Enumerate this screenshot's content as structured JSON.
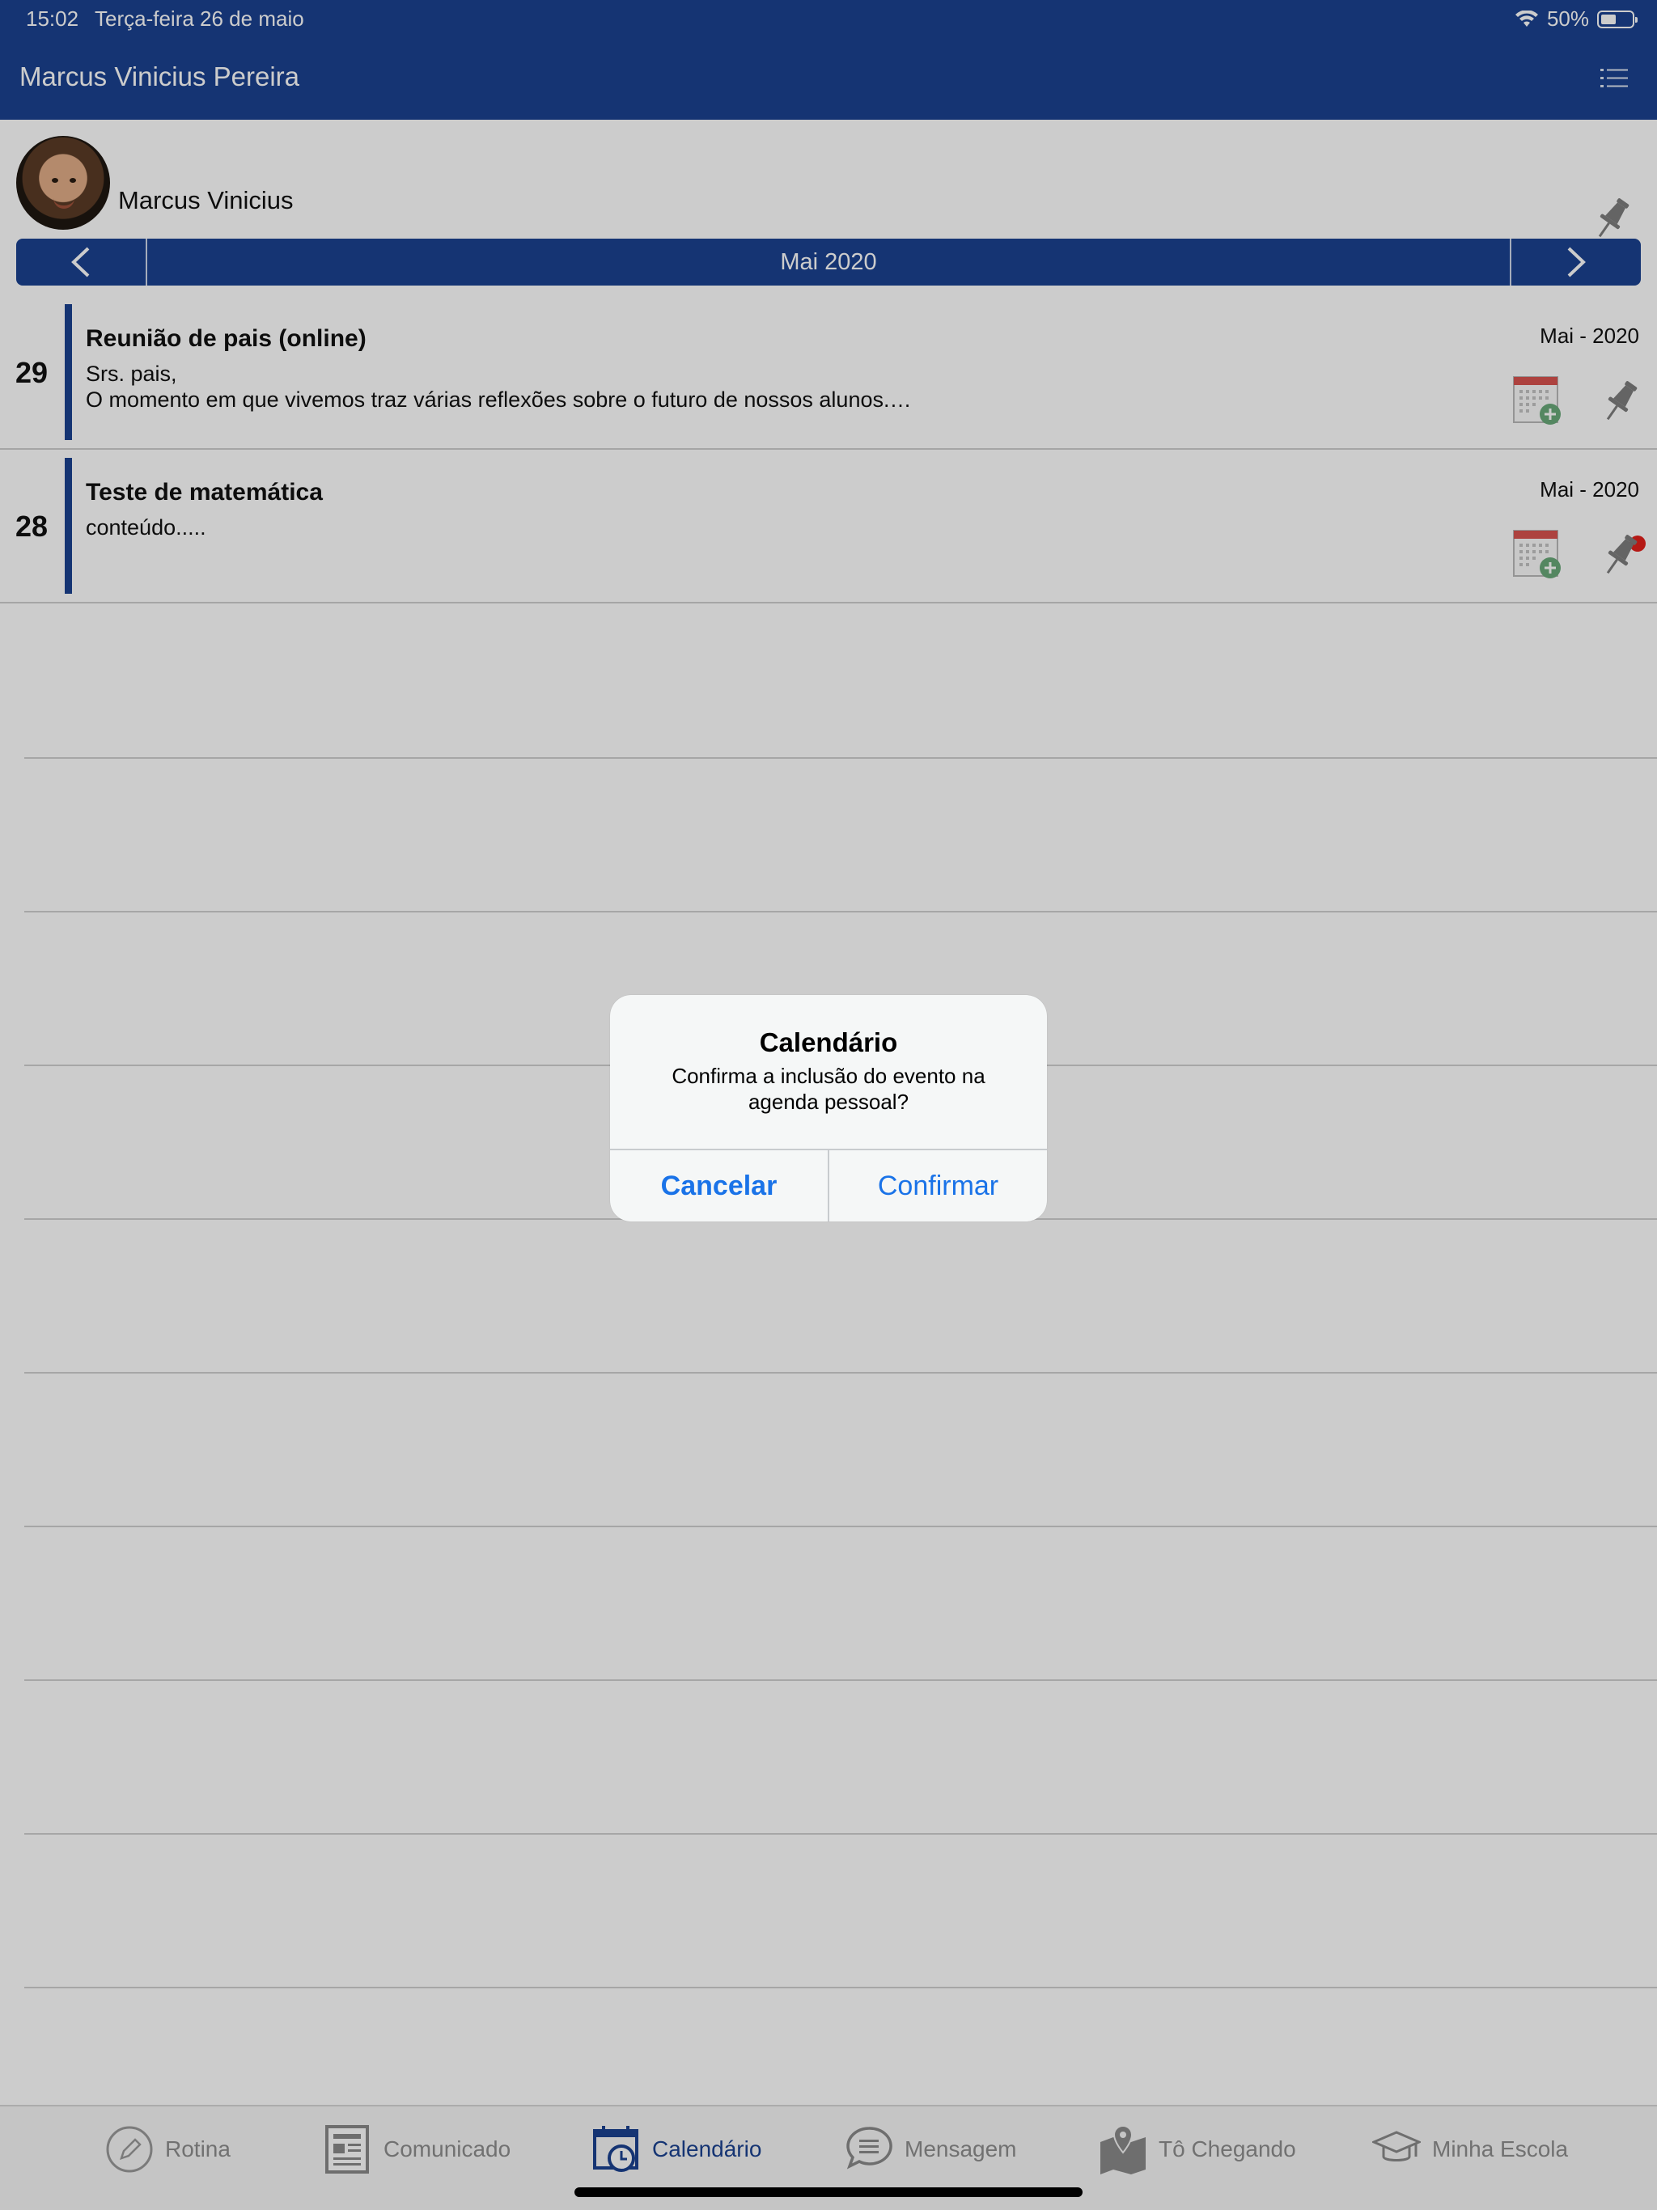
{
  "status": {
    "time": "15:02",
    "date": "Terça-feira 26 de maio",
    "battery": "50%",
    "battery_level": 0.5
  },
  "header": {
    "title": "Marcus Vinicius Pereira",
    "menu_icon": "list-icon"
  },
  "profile": {
    "name": "Marcus Vinicius"
  },
  "month": {
    "label": "Mai 2020",
    "prev_icon": "chevron-left-icon",
    "next_icon": "chevron-right-icon"
  },
  "events": [
    {
      "day": "29",
      "title": "Reunião de pais (online)",
      "body": "Srs. pais,\nO momento em que vivemos traz várias reflexões sobre o futuro de nossos alunos.…",
      "date": "Mai - 2020",
      "unread": false
    },
    {
      "day": "28",
      "title": "Teste de matemática",
      "body": "conteúdo.....",
      "date": "Mai - 2020",
      "unread": true
    }
  ],
  "dialog": {
    "title": "Calendário",
    "message": "Confirma a inclusão do evento na agenda pessoal?",
    "cancel": "Cancelar",
    "confirm": "Confirmar"
  },
  "tabs": [
    {
      "label": "Rotina",
      "icon": "pencil-circle-icon",
      "active": false
    },
    {
      "label": "Comunicado",
      "icon": "newspaper-icon",
      "active": false
    },
    {
      "label": "Calendário",
      "icon": "calendar-clock-icon",
      "active": true
    },
    {
      "label": "Mensagem",
      "icon": "chat-bubble-icon",
      "active": false
    },
    {
      "label": "Tô Chegando",
      "icon": "map-pin-icon",
      "active": false
    },
    {
      "label": "Minha Escola",
      "icon": "graduation-cap-icon",
      "active": false
    }
  ],
  "colors": {
    "primary": "#1b4290",
    "dialog_button": "#1a73e8",
    "unread_dot": "#e3201b"
  }
}
